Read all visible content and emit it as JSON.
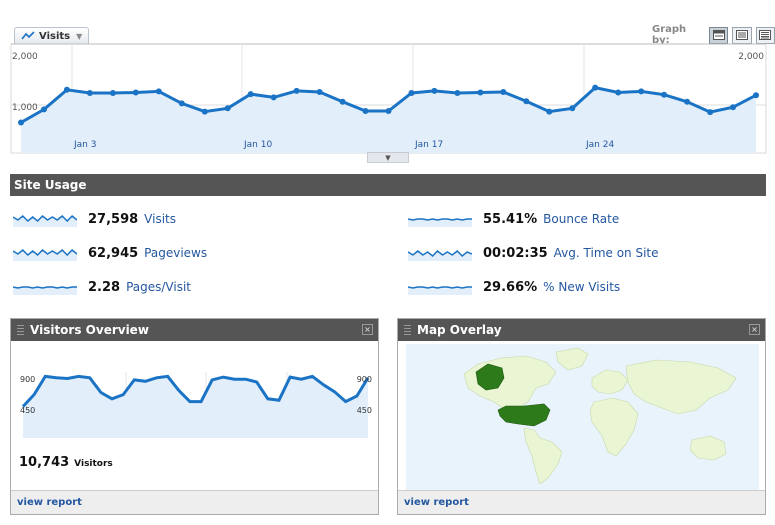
{
  "metric_selector": {
    "label": "Visits"
  },
  "graph_by": {
    "label": "Graph by:"
  },
  "main_chart": {
    "y_labels": [
      "2,000",
      "1,000"
    ],
    "x_labels": [
      "Jan 3",
      "Jan 10",
      "Jan 17",
      "Jan 24"
    ]
  },
  "chart_data": {
    "type": "area",
    "xlabel": "",
    "ylabel": "",
    "ylim": [
      0,
      2000
    ],
    "series": [
      {
        "values": [
          560,
          800,
          1160,
          1100,
          1100,
          1110,
          1130,
          910,
          760,
          820,
          1080,
          1020,
          1140,
          1120,
          940,
          770,
          770,
          1100,
          1140,
          1100,
          1110,
          1120,
          950,
          760,
          820,
          1200,
          1110,
          1130,
          1070,
          940,
          750,
          840,
          1060
        ]
      }
    ]
  },
  "site_usage": {
    "title": "Site Usage",
    "metrics": [
      {
        "value": "27,598",
        "label": "Visits"
      },
      {
        "value": "62,945",
        "label": "Pageviews"
      },
      {
        "value": "2.28",
        "label": "Pages/Visit"
      },
      {
        "value": "55.41%",
        "label": "Bounce Rate"
      },
      {
        "value": "00:02:35",
        "label": "Avg. Time on Site"
      },
      {
        "value": "29.66%",
        "label": "% New Visits"
      }
    ]
  },
  "visitors_overview": {
    "title": "Visitors Overview",
    "y_left": [
      "900",
      "450"
    ],
    "y_right": [
      "900",
      "450"
    ],
    "values": [
      450,
      620,
      880,
      860,
      850,
      880,
      860,
      650,
      560,
      620,
      830,
      810,
      860,
      880,
      680,
      520,
      520,
      830,
      870,
      840,
      840,
      800,
      560,
      540,
      870,
      840,
      880,
      760,
      660,
      520,
      600,
      860
    ],
    "count": "10,743",
    "unit": "Visitors",
    "link": "view report"
  },
  "map_overlay": {
    "title": "Map Overlay",
    "link": "view report"
  },
  "colors": {
    "line": "#1a73c4",
    "fill": "#e2eef9",
    "header": "#555555",
    "link": "#2457a0",
    "land": "#eaf5d4",
    "highlight": "#2d7a1a"
  }
}
